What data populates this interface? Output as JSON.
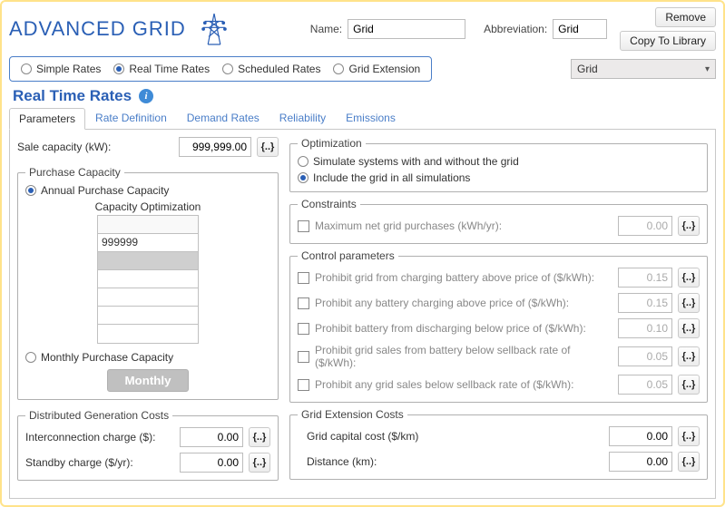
{
  "header": {
    "title": "ADVANCED GRID",
    "name_label": "Name:",
    "name_value": "Grid",
    "abbrev_label": "Abbreviation:",
    "abbrev_value": "Grid",
    "remove_label": "Remove",
    "copy_label": "Copy To Library"
  },
  "rate_types": {
    "items": [
      {
        "label": "Simple Rates",
        "checked": false
      },
      {
        "label": "Real Time Rates",
        "checked": true
      },
      {
        "label": "Scheduled Rates",
        "checked": false
      },
      {
        "label": "Grid Extension",
        "checked": false
      }
    ]
  },
  "dropdown": {
    "selected": "Grid"
  },
  "section": {
    "title": "Real Time Rates"
  },
  "tabs": [
    {
      "label": "Parameters",
      "active": true
    },
    {
      "label": "Rate Definition",
      "active": false
    },
    {
      "label": "Demand Rates",
      "active": false
    },
    {
      "label": "Reliability",
      "active": false
    },
    {
      "label": "Emissions",
      "active": false
    }
  ],
  "left": {
    "sale_capacity_label": "Sale capacity (kW):",
    "sale_capacity_value": "999,999.00",
    "purchase_capacity_legend": "Purchase Capacity",
    "annual_label": "Annual Purchase Capacity",
    "annual_checked": true,
    "cap_opt_title": "Capacity Optimization",
    "cap_opt_values": [
      "999999"
    ],
    "monthly_label": "Monthly Purchase Capacity",
    "monthly_checked": false,
    "monthly_btn": "Monthly",
    "dgc_legend": "Distributed Generation Costs",
    "interconnection_label": "Interconnection charge ($):",
    "interconnection_value": "0.00",
    "standby_label": "Standby charge ($/yr):",
    "standby_value": "0.00"
  },
  "right": {
    "opt_legend": "Optimization",
    "opt_simulate_label": "Simulate systems with and without the grid",
    "opt_include_label": "Include the grid in all simulations",
    "opt_selected": "include",
    "constraints_legend": "Constraints",
    "max_net_label": "Maximum net grid purchases (kWh/yr):",
    "max_net_value": "0.00",
    "cp_legend": "Control parameters",
    "cp_items": [
      {
        "label": "Prohibit grid from charging battery above price of ($/kWh):",
        "value": "0.15"
      },
      {
        "label": "Prohibit any battery charging above price of ($/kWh):",
        "value": "0.15"
      },
      {
        "label": "Prohibit battery from discharging below price of ($/kWh):",
        "value": "0.10"
      },
      {
        "label": "Prohibit grid sales from battery below sellback rate of ($/kWh):",
        "value": "0.05"
      },
      {
        "label": "Prohibit any grid sales below sellback rate of ($/kWh):",
        "value": "0.05"
      }
    ],
    "ext_legend": "Grid Extension Costs",
    "ext_capital_label": "Grid capital cost ($/km)",
    "ext_capital_value": "0.00",
    "ext_distance_label": "Distance (km):",
    "ext_distance_value": "0.00"
  },
  "glyphs": {
    "sens": "{..}"
  }
}
